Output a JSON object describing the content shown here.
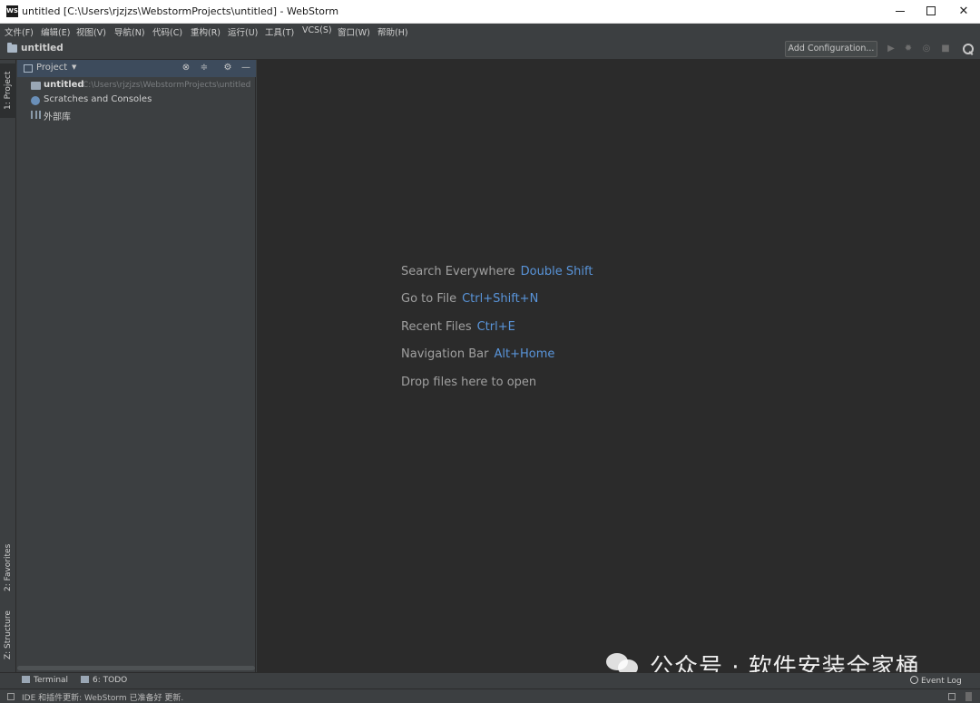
{
  "window": {
    "title": "untitled [C:\\Users\\rjzjzs\\WebstormProjects\\untitled] - WebStorm",
    "logo": "WS"
  },
  "menu": [
    {
      "label": "文件(F)"
    },
    {
      "label": "编辑(E)"
    },
    {
      "label": "视图(V)"
    },
    {
      "label": "导航(N)"
    },
    {
      "label": "代码(C)"
    },
    {
      "label": "重构(R)"
    },
    {
      "label": "运行(U)"
    },
    {
      "label": "工具(T)"
    },
    {
      "label": "VCS(S)"
    },
    {
      "label": "窗口(W)"
    },
    {
      "label": "帮助(H)"
    }
  ],
  "navbar": {
    "project_name": "untitled",
    "add_configuration": "Add Configuration..."
  },
  "left_tabs": {
    "project": "1: Project",
    "favorites": "2: Favorites",
    "structure": "Z: Structure"
  },
  "project_panel": {
    "title": "Project",
    "tree": [
      {
        "label": "untitled",
        "path": "C:\\Users\\rjzjzs\\WebstormProjects\\untitled",
        "icon": "folder-icon"
      },
      {
        "label": "Scratches and Consoles",
        "path": "",
        "icon": "scratches-icon"
      },
      {
        "label": "外部库",
        "path": "",
        "icon": "library-icon"
      }
    ]
  },
  "editor": {
    "hints": [
      {
        "text": "Search Everywhere",
        "key": "Double Shift"
      },
      {
        "text": "Go to File",
        "key": "Ctrl+Shift+N"
      },
      {
        "text": "Recent Files",
        "key": "Ctrl+E"
      },
      {
        "text": "Navigation Bar",
        "key": "Alt+Home"
      },
      {
        "text": "Drop files here to open",
        "key": ""
      }
    ]
  },
  "bottom_tabs": {
    "terminal": "Terminal",
    "todo": "6: TODO",
    "event_log": "Event Log"
  },
  "status": {
    "message": "IDE 和插件更新: WebStorm 已准备好 更新."
  },
  "watermark": {
    "text": "公众号 · 软件安装全家桶"
  },
  "colors": {
    "editor_bg": "#2b2b2b",
    "panel_bg": "#3c3f41",
    "shortcut_blue": "#5994d9"
  }
}
